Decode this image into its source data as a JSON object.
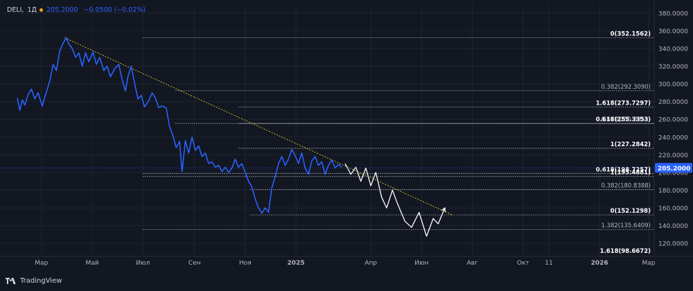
{
  "header": {
    "symbol": "DELI",
    "timeframe": "1Д",
    "last": "205.2000",
    "change": "−0.0500 (−0.02%)"
  },
  "branding": {
    "name": "TradingView"
  },
  "colors": {
    "background": "#131722",
    "price_line": "#2962ff",
    "projection": "#ffffff",
    "trendline": "#c8c82a",
    "fib_lines": "#b2b5be",
    "grid": "#1f2430",
    "axis_text": "#b2b5be",
    "price_tag": "#2962ff"
  },
  "chart_data": {
    "type": "line",
    "title": "",
    "yaxis": {
      "ylim": [
        110,
        390
      ],
      "ticks": [
        120,
        140,
        160,
        180,
        200,
        220,
        240,
        260,
        280,
        300,
        320,
        340,
        360,
        380
      ],
      "tick_labels": [
        "120.0000",
        "140.0000",
        "160.0000",
        "180.0000",
        "200.0000",
        "220.0000",
        "240.0000",
        "260.0000",
        "280.0000",
        "300.0000",
        "320.0000",
        "340.0000",
        "360.0000",
        "380.0000"
      ]
    },
    "xaxis": {
      "labels": [
        {
          "label": "Мар",
          "date": "2024-03-01"
        },
        {
          "label": "Май",
          "date": "2024-05-01"
        },
        {
          "label": "Июл",
          "date": "2024-07-01"
        },
        {
          "label": "Сен",
          "date": "2024-09-01"
        },
        {
          "label": "Ноя",
          "date": "2024-11-01"
        },
        {
          "label": "2025",
          "date": "2025-01-01"
        },
        {
          "label": "Апр",
          "date": "2025-04-01"
        },
        {
          "label": "Июн",
          "date": "2025-06-01"
        },
        {
          "label": "Авг",
          "date": "2025-08-01"
        },
        {
          "label": "Окт",
          "date": "2025-10-01"
        },
        {
          "label": "11",
          "date": "2025-11-01"
        },
        {
          "label": "2026",
          "date": "2026-01-01"
        },
        {
          "label": "Мар",
          "date": "2026-03-01"
        }
      ]
    },
    "last_price": {
      "value": 205.2,
      "label": "205.2000"
    },
    "series": [
      {
        "name": "DELI",
        "kind": "price",
        "points": [
          [
            "2024-02-01",
            284
          ],
          [
            "2024-02-04",
            270
          ],
          [
            "2024-02-07",
            282
          ],
          [
            "2024-02-10",
            276
          ],
          [
            "2024-02-14",
            288
          ],
          [
            "2024-02-18",
            294
          ],
          [
            "2024-02-22",
            283
          ],
          [
            "2024-02-26",
            290
          ],
          [
            "2024-03-02",
            275
          ],
          [
            "2024-03-06",
            288
          ],
          [
            "2024-03-11",
            303
          ],
          [
            "2024-03-15",
            322
          ],
          [
            "2024-03-19",
            315
          ],
          [
            "2024-03-23",
            337
          ],
          [
            "2024-03-27",
            346
          ],
          [
            "2024-03-31",
            352
          ],
          [
            "2024-04-03",
            345
          ],
          [
            "2024-04-07",
            340
          ],
          [
            "2024-04-11",
            330
          ],
          [
            "2024-04-15",
            335
          ],
          [
            "2024-04-19",
            320
          ],
          [
            "2024-04-23",
            335
          ],
          [
            "2024-04-27",
            325
          ],
          [
            "2024-05-02",
            336
          ],
          [
            "2024-05-06",
            322
          ],
          [
            "2024-05-10",
            330
          ],
          [
            "2024-05-15",
            315
          ],
          [
            "2024-05-19",
            320
          ],
          [
            "2024-05-23",
            308
          ],
          [
            "2024-05-28",
            317
          ],
          [
            "2024-06-02",
            322
          ],
          [
            "2024-06-06",
            305
          ],
          [
            "2024-06-10",
            292
          ],
          [
            "2024-06-13",
            308
          ],
          [
            "2024-06-17",
            320
          ],
          [
            "2024-06-21",
            301
          ],
          [
            "2024-06-25",
            283
          ],
          [
            "2024-06-29",
            287
          ],
          [
            "2024-07-03",
            274
          ],
          [
            "2024-07-08",
            281
          ],
          [
            "2024-07-12",
            290
          ],
          [
            "2024-07-16",
            284
          ],
          [
            "2024-07-20",
            273
          ],
          [
            "2024-07-24",
            275
          ],
          [
            "2024-07-29",
            273
          ],
          [
            "2024-08-02",
            252
          ],
          [
            "2024-08-06",
            242
          ],
          [
            "2024-08-10",
            228
          ],
          [
            "2024-08-14",
            235
          ],
          [
            "2024-08-17",
            201
          ],
          [
            "2024-08-21",
            236
          ],
          [
            "2024-08-25",
            222
          ],
          [
            "2024-08-29",
            240
          ],
          [
            "2024-09-02",
            225
          ],
          [
            "2024-09-06",
            230
          ],
          [
            "2024-09-10",
            218
          ],
          [
            "2024-09-14",
            222
          ],
          [
            "2024-09-18",
            210
          ],
          [
            "2024-09-22",
            212
          ],
          [
            "2024-09-26",
            206
          ],
          [
            "2024-09-30",
            208
          ],
          [
            "2024-10-04",
            201
          ],
          [
            "2024-10-08",
            206
          ],
          [
            "2024-10-12",
            200
          ],
          [
            "2024-10-16",
            205
          ],
          [
            "2024-10-20",
            215
          ],
          [
            "2024-10-24",
            206
          ],
          [
            "2024-10-28",
            210
          ],
          [
            "2024-11-01",
            200
          ],
          [
            "2024-11-05",
            190
          ],
          [
            "2024-11-09",
            184
          ],
          [
            "2024-11-13",
            170
          ],
          [
            "2024-11-17",
            160
          ],
          [
            "2024-11-21",
            154
          ],
          [
            "2024-11-25",
            160
          ],
          [
            "2024-11-29",
            155
          ],
          [
            "2024-12-03",
            183
          ],
          [
            "2024-12-07",
            195
          ],
          [
            "2024-12-11",
            210
          ],
          [
            "2024-12-15",
            218
          ],
          [
            "2024-12-19",
            208
          ],
          [
            "2024-12-23",
            215
          ],
          [
            "2024-12-27",
            226
          ],
          [
            "2024-12-31",
            219
          ],
          [
            "2025-01-04",
            210
          ],
          [
            "2025-01-08",
            222
          ],
          [
            "2025-01-12",
            205
          ],
          [
            "2025-01-16",
            198
          ],
          [
            "2025-01-20",
            213
          ],
          [
            "2025-01-24",
            218
          ],
          [
            "2025-01-28",
            208
          ],
          [
            "2025-02-01",
            212
          ],
          [
            "2025-02-05",
            198
          ],
          [
            "2025-02-09",
            208
          ],
          [
            "2025-02-13",
            214
          ],
          [
            "2025-02-17",
            205
          ],
          [
            "2025-02-21",
            209
          ],
          [
            "2025-02-25",
            206
          ]
        ]
      },
      {
        "name": "",
        "kind": "projection",
        "points": [
          [
            "2025-03-01",
            210
          ],
          [
            "2025-03-08",
            198
          ],
          [
            "2025-03-14",
            206
          ],
          [
            "2025-03-20",
            190
          ],
          [
            "2025-03-26",
            205
          ],
          [
            "2025-04-01",
            185
          ],
          [
            "2025-04-07",
            200
          ],
          [
            "2025-04-14",
            172
          ],
          [
            "2025-04-20",
            160
          ],
          [
            "2025-04-27",
            180
          ],
          [
            "2025-05-03",
            165
          ],
          [
            "2025-05-12",
            145
          ],
          [
            "2025-05-20",
            138
          ],
          [
            "2025-05-29",
            155
          ],
          [
            "2025-06-07",
            128
          ],
          [
            "2025-06-15",
            148
          ],
          [
            "2025-06-21",
            142
          ],
          [
            "2025-06-29",
            160
          ]
        ]
      }
    ],
    "trendline": {
      "from": {
        "date": "2024-03-29",
        "value": 352
      },
      "to": {
        "date": "2025-07-08",
        "value": 152
      }
    },
    "fib_levels": [
      {
        "label": "0(352.1562)",
        "value": 352.1562,
        "start": "2024-07-01",
        "bold": true
      },
      {
        "label": "0.382(292.3090)",
        "value": 292.309,
        "start": "2024-08-09",
        "bold": false
      },
      {
        "label": "1.618(273.7297)",
        "value": 273.7297,
        "start": "2024-10-24",
        "bold": true
      },
      {
        "label": "0.618(255.3353)",
        "value": 255.3353,
        "start": "2024-08-09",
        "bold": false
      },
      {
        "label": "0.618(255.3353)",
        "value": 255.3353,
        "start": "2024-10-24",
        "bold": true
      },
      {
        "label": "1(227.2842)",
        "value": 227.2842,
        "start": "2024-10-24",
        "bold": true
      },
      {
        "label": "0.618(198.7257)",
        "value": 198.7257,
        "start": "2024-07-01",
        "bold": true
      },
      {
        "label": "1(195.4881)",
        "value": 195.4881,
        "start": "2024-07-01",
        "bold": true
      },
      {
        "label": "0.382(180.8388)",
        "value": 180.8388,
        "start": "2024-11-07",
        "bold": false
      },
      {
        "label": "0(152.1298)",
        "value": 152.1298,
        "start": "2024-11-07",
        "bold": true
      },
      {
        "label": "1.382(135.6409)",
        "value": 135.6409,
        "start": "2024-07-01",
        "bold": false
      },
      {
        "label": "1.618(98.6672)",
        "value": 98.6672,
        "start": null,
        "bold": true
      }
    ]
  }
}
